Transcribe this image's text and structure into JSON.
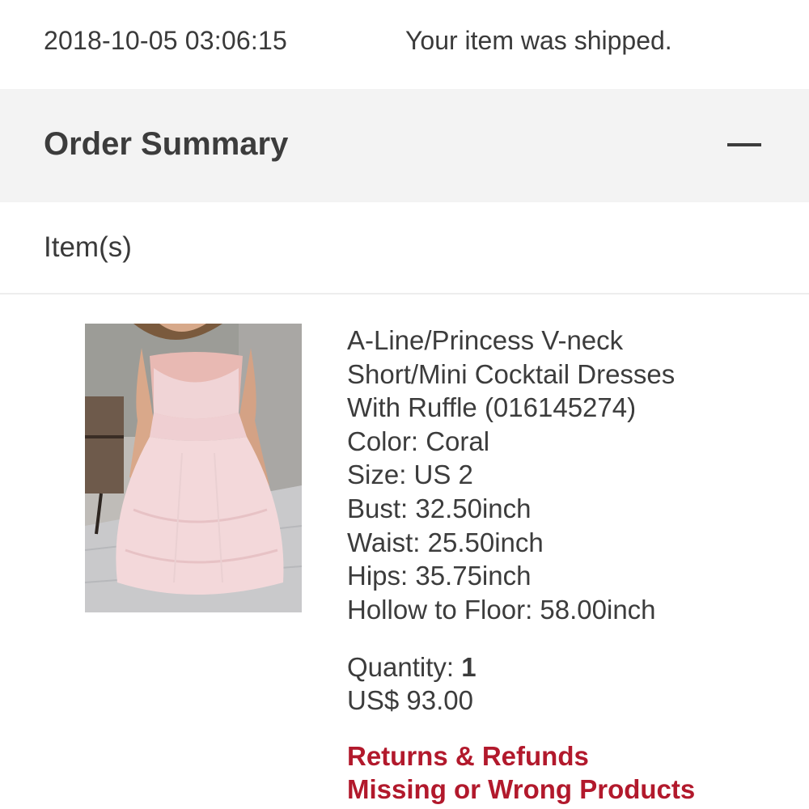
{
  "shipping": {
    "timestamp": "2018-10-05 03:06:15",
    "status": "Your item was shipped."
  },
  "order_summary": {
    "title": "Order Summary",
    "collapse_icon": "minus-icon"
  },
  "items_section": {
    "label": "Item(s)"
  },
  "product": {
    "image_icon": "dress-photo",
    "name_lines": [
      "A-Line/Princess V-neck",
      "Short/Mini Cocktail Dresses",
      "With Ruffle (016145274)"
    ],
    "attributes": [
      "Color: Coral",
      "Size: US 2",
      "Bust: 32.50inch",
      "Waist: 25.50inch",
      "Hips: 35.75inch",
      "Hollow to Floor: 58.00inch"
    ],
    "quantity_label": "Quantity: ",
    "quantity_value": "1",
    "price": "US$ 93.00"
  },
  "links": {
    "returns": "Returns & Refunds",
    "missing": "Missing or Wrong Products"
  },
  "colors": {
    "link": "#b2192c",
    "summary_bg": "#f3f3f3",
    "text": "#3c3c3c"
  }
}
